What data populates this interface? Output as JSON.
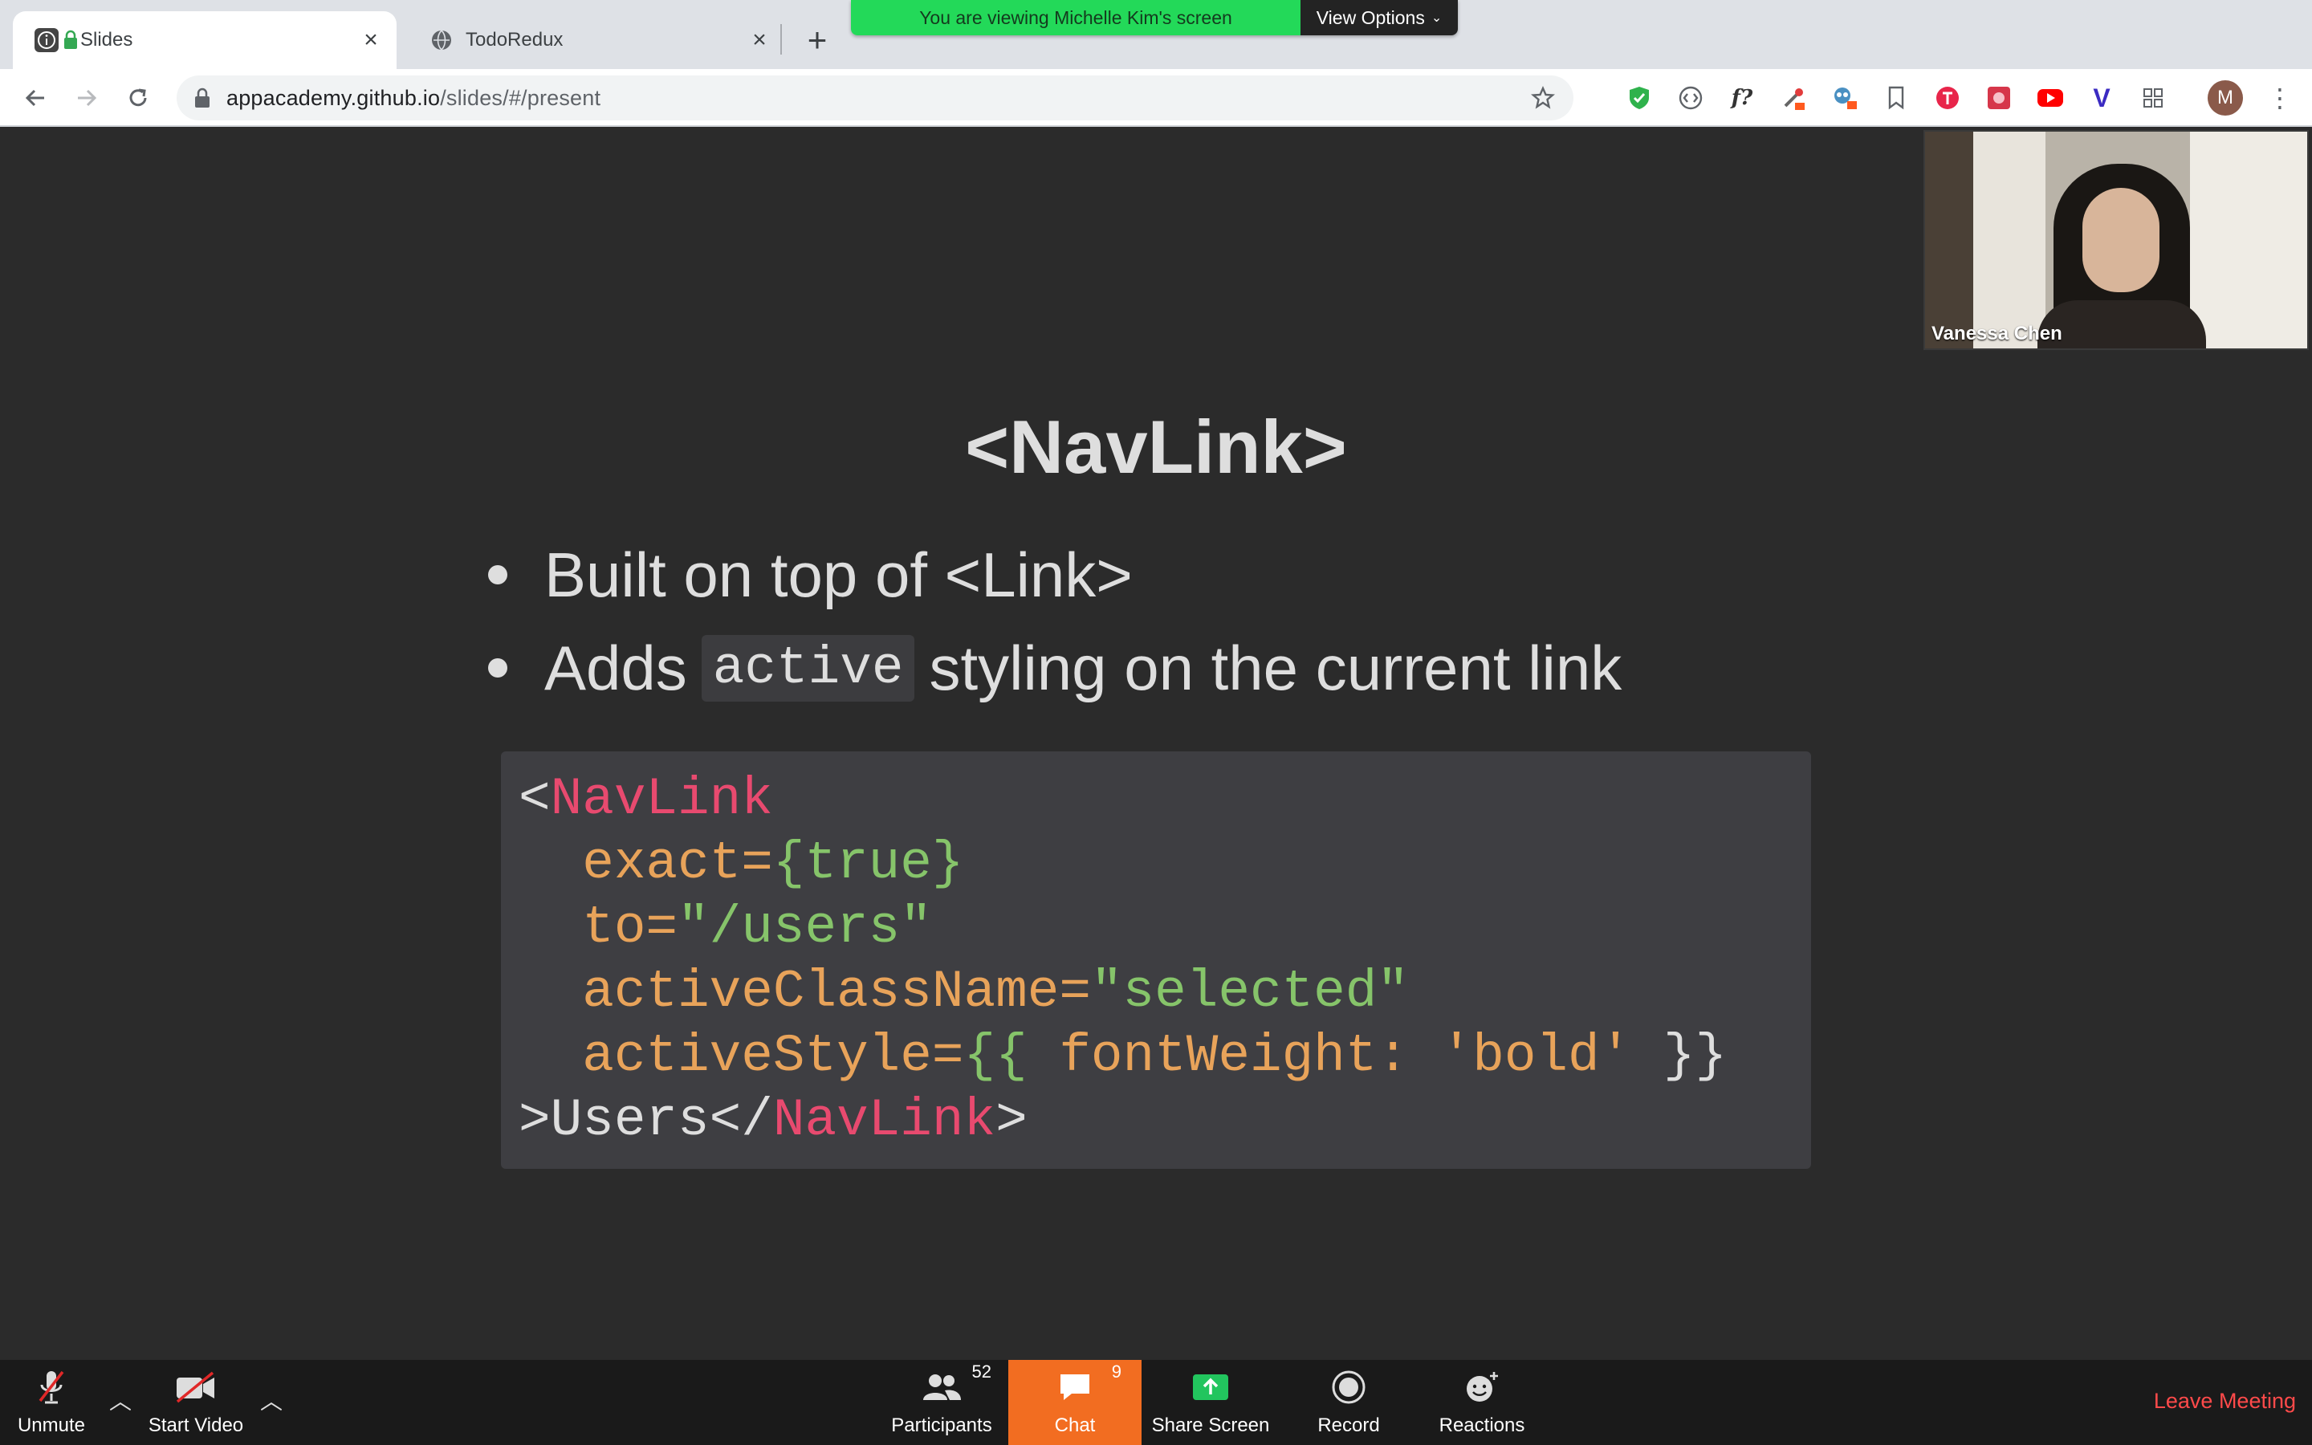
{
  "browser": {
    "tabs": [
      {
        "title": "Slides",
        "active": true,
        "favicon": "info-icon"
      },
      {
        "title": "TodoRedux",
        "active": false,
        "favicon": "globe-icon"
      }
    ],
    "address": {
      "host": "appacademy.github.io",
      "path": "/slides/#/present"
    }
  },
  "share_banner": {
    "text": "You are viewing Michelle Kim's screen",
    "view_options": "View Options"
  },
  "slide": {
    "title": "<NavLink>",
    "bullets": [
      {
        "text": "Built on top of <Link>"
      },
      {
        "pre": "Adds",
        "code": "active",
        "post": "styling on the current link"
      }
    ],
    "code": {
      "line1_open": "<",
      "line1_tag": "NavLink",
      "line2_attr": "exact=",
      "line2_val": "{true}",
      "line3_attr": "to=",
      "line3_val": "\"/users\"",
      "line4_attr": "activeClassName=",
      "line4_val": "\"selected\"",
      "line5_attr": "activeStyle=",
      "line5_val_open": "{{ ",
      "line5_key": "fontWeight: ",
      "line5_str": "'bold'",
      "line5_val_close": " }}",
      "line6_text": ">Users</",
      "line6_tag": "NavLink",
      "line6_close": ">"
    }
  },
  "video": {
    "participant_name": "Vanessa Chen"
  },
  "zoom_controls": {
    "unmute": "Unmute",
    "start_video": "Start Video",
    "participants": "Participants",
    "participants_count": "52",
    "chat": "Chat",
    "chat_count": "9",
    "share_screen": "Share Screen",
    "record": "Record",
    "reactions": "Reactions",
    "leave": "Leave Meeting"
  },
  "profile": {
    "initial": "M"
  },
  "colors": {
    "share_banner": "#23d959",
    "chat_active": "#f26d21",
    "leave": "#ff4a4a",
    "code_tag": "#e84a6f",
    "code_attr": "#e8a35a",
    "code_value": "#86c46a"
  }
}
